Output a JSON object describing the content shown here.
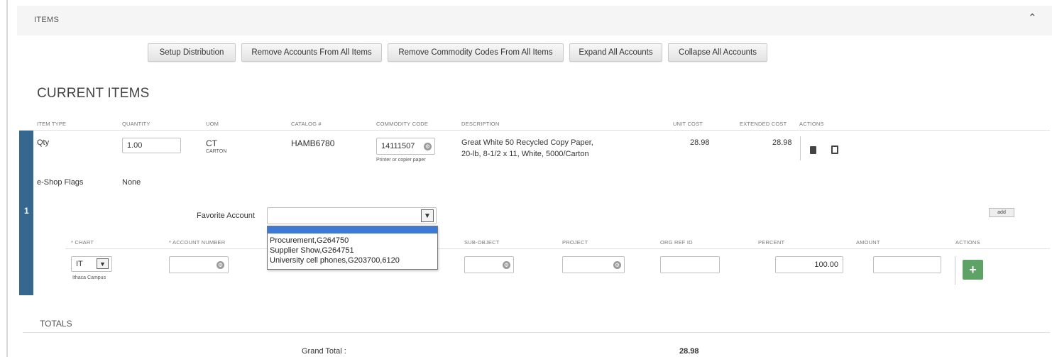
{
  "section": {
    "title": "ITEMS",
    "collapse_icon": "chevron-up-icon"
  },
  "toolbar": {
    "setup_distribution": "Setup Distribution",
    "remove_accounts": "Remove Accounts From All Items",
    "remove_commodity": "Remove Commodity Codes From All Items",
    "expand_all": "Expand All Accounts",
    "collapse_all": "Collapse All Accounts"
  },
  "current_items": {
    "heading": "CURRENT ITEMS",
    "columns": [
      "ITEM TYPE",
      "QUANTITY",
      "UOM",
      "CATALOG #",
      "COMMODITY CODE",
      "DESCRIPTION",
      "UNIT COST",
      "EXTENDED COST",
      "ACTIONS"
    ],
    "item": {
      "row_number": "1",
      "item_type": "Qty",
      "quantity": "1.00",
      "uom": "CT",
      "uom_desc": "CARTON",
      "catalog": "HAMB6780",
      "commodity_code": "14111507",
      "commodity_desc": "Printer or copier paper",
      "description_line1": "Great White 50 Recycled Copy Paper,",
      "description_line2": "20-lb, 8-1/2 x 11, White, 5000/Carton",
      "unit_cost": "28.98",
      "extended_cost": "28.98",
      "eshop_label": "e-Shop Flags",
      "eshop_value": "None"
    }
  },
  "favorite_account": {
    "label": "Favorite Account",
    "value": "",
    "options": [
      "Procurement,G264750",
      "Supplier Show,G264751",
      "University cell phones,G203700,6120"
    ],
    "add_label": "add"
  },
  "account_columns": [
    "* CHART",
    "* ACCOUNT NUMBER",
    "SUB-OBJECT",
    "PROJECT",
    "ORG REF ID",
    "PERCENT",
    "AMOUNT",
    "ACTIONS"
  ],
  "account_row": {
    "chart": "IT",
    "chart_desc": "Ithaca Campus",
    "account_number": "",
    "sub_object": "",
    "project": "",
    "org_ref_id": "",
    "percent": "100.00",
    "amount": ""
  },
  "totals": {
    "heading": "TOTALS",
    "grand_total_label": "Grand Total :",
    "grand_total_value": "28.98"
  }
}
